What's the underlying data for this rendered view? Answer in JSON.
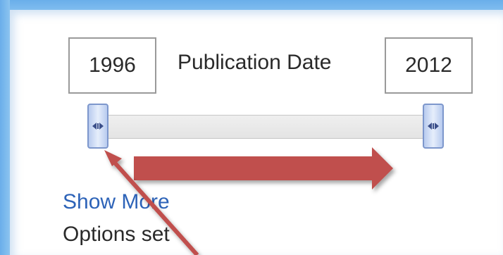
{
  "date_filter": {
    "title": "Publication Date",
    "start_year": "1996",
    "end_year": "2012",
    "handle_icon": "double-arrow-grip-icon"
  },
  "links": {
    "show_more": "Show More"
  },
  "status": {
    "options_set": "Options set"
  },
  "annotations": {
    "drag_right_arrow_color": "#c0504d",
    "pointer_arrow_color": "#c0504d"
  }
}
